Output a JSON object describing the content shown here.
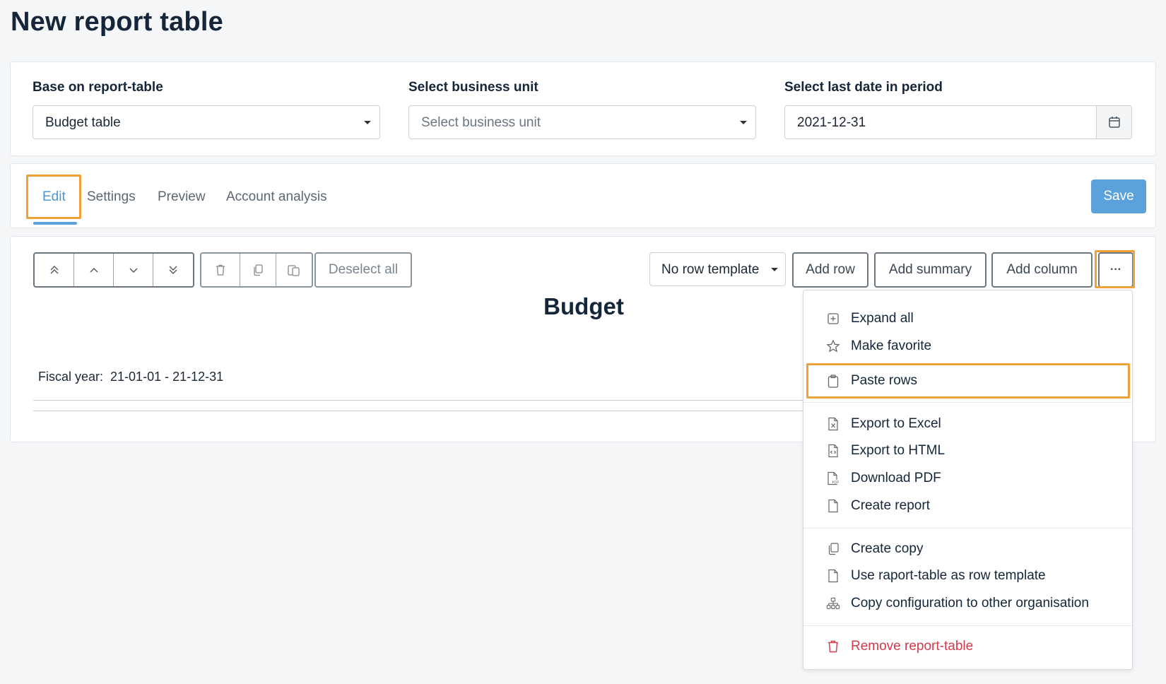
{
  "page": {
    "title": "New report table"
  },
  "filters": {
    "base": {
      "label": "Base on report-table",
      "value": "Budget table"
    },
    "unit": {
      "label": "Select business unit",
      "placeholder": "Select business unit"
    },
    "date": {
      "label": "Select last date in period",
      "value": "2021-12-31"
    }
  },
  "tabs": [
    {
      "label": "Edit",
      "active": true
    },
    {
      "label": "Settings"
    },
    {
      "label": "Preview"
    },
    {
      "label": "Account analysis"
    }
  ],
  "save_label": "Save",
  "toolbar": {
    "deselect_label": "Deselect all",
    "row_template": "No row template",
    "add_row": "Add row",
    "add_summary": "Add summary",
    "add_column": "Add column",
    "more": "···"
  },
  "report": {
    "title": "Budget",
    "fiscal_label": "Fiscal year:",
    "fiscal_value": "21-01-01 - 21-12-31"
  },
  "menu": {
    "expand_all": "Expand all",
    "make_favorite": "Make favorite",
    "paste_rows": "Paste rows",
    "export_excel": "Export to Excel",
    "export_html": "Export to HTML",
    "download_pdf": "Download PDF",
    "create_report": "Create report",
    "create_copy": "Create copy",
    "use_template": "Use raport-table as row template",
    "copy_config": "Copy configuration to other organisation",
    "remove": "Remove report-table"
  },
  "colors": {
    "accent": "#5ba2dc",
    "highlight": "#f0a23a",
    "danger": "#d63b4a"
  }
}
